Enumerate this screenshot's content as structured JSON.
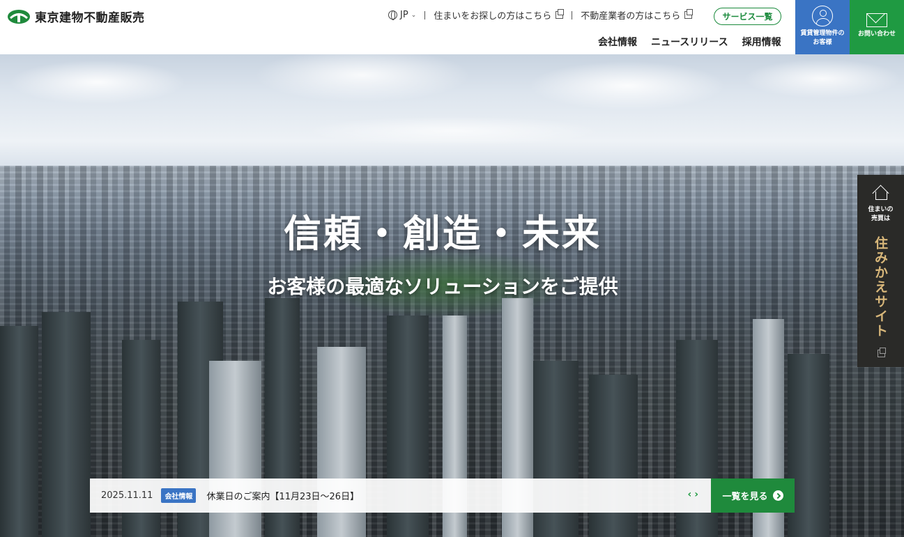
{
  "header": {
    "logo_text": "東京建物不動産販売",
    "language": "JP",
    "util_links": [
      {
        "label": "住まいをお探しの方はこちら"
      },
      {
        "label": "不動産業者の方はこちら"
      }
    ],
    "service_label": "サービス一覧",
    "main_nav": [
      {
        "label": "会社情報"
      },
      {
        "label": "ニュースリリース"
      },
      {
        "label": "採用情報"
      }
    ],
    "tiles": {
      "rental_line1": "賃貸管理物件の",
      "rental_line2": "お客様",
      "contact": "お問い合わせ"
    }
  },
  "hero": {
    "title": "信頼・創造・未来",
    "subtitle": "お客様の最適なソリューションをご提供"
  },
  "side_banner": {
    "small_line1": "住まいの",
    "small_line2": "売買は",
    "big": "住みかえサイト"
  },
  "news": {
    "date": "2025.11.11",
    "badge": "会社情報",
    "title": "休業日のご案内【11月23日〜26日】",
    "prev": "‹",
    "next": "›",
    "more_label": "一覧を見る"
  },
  "colors": {
    "brand_green": "#1f8a3c",
    "rental_blue": "#3a74c4",
    "side_gold": "#d8b77a"
  }
}
